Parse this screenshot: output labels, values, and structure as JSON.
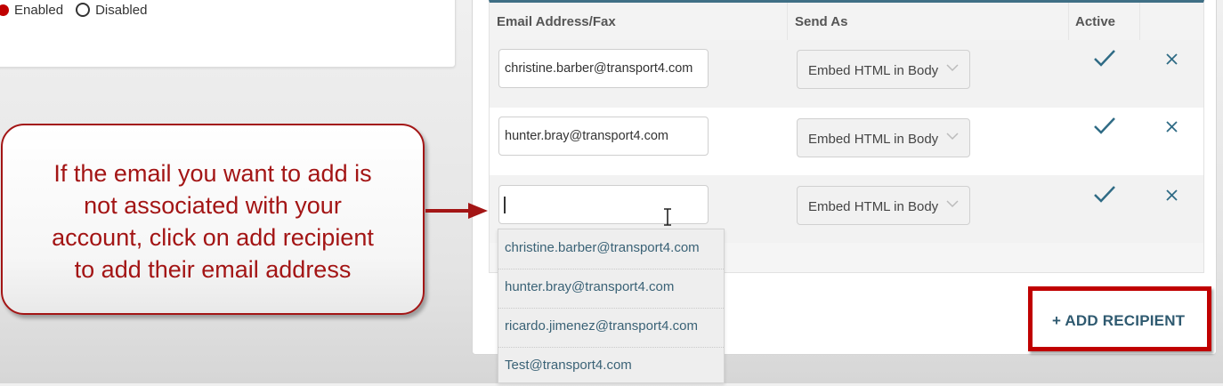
{
  "status_radio": {
    "enabled_label": "Enabled",
    "disabled_label": "Disabled",
    "selected": "Enabled"
  },
  "table": {
    "headers": {
      "email": "Email Address/Fax",
      "send_as": "Send As",
      "active": "Active"
    },
    "rows": [
      {
        "email": "christine.barber@transport4.com",
        "send_as": "Embed HTML in Body",
        "active": true
      },
      {
        "email": "hunter.bray@transport4.com",
        "send_as": "Embed HTML in Body",
        "active": true
      },
      {
        "email": "",
        "send_as": "Embed HTML in Body",
        "active": true
      }
    ]
  },
  "suggestions": [
    "christine.barber@transport4.com",
    "hunter.bray@transport4.com",
    "ricardo.jimenez@transport4.com",
    "Test@transport4.com"
  ],
  "add_recipient_label": "+ ADD RECIPIENT",
  "callout": {
    "lines": [
      "If the email you want to add is",
      "not associated with your",
      "account, click on add recipient",
      "to add their email address"
    ]
  },
  "colors": {
    "accent_red": "#c00000",
    "callout_red": "#a31515",
    "link_teal": "#3a6276",
    "check_teal": "#2f6b85",
    "header_bar": "#3f6f85"
  },
  "icons": {
    "check": "check-icon",
    "remove": "close-icon",
    "dropdown": "chevron-down-icon",
    "cursor": "text-cursor-icon"
  }
}
